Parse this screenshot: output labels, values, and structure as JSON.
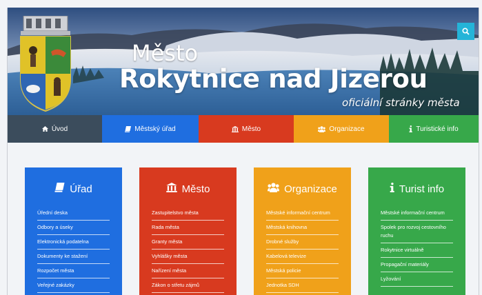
{
  "header": {
    "title_small": "Město",
    "title_big": "Rokytnice nad Jizerou",
    "subtitle": "oficiální stránky města",
    "search_icon": "search-icon"
  },
  "nav": [
    {
      "label": "Úvod",
      "icon": "home-icon",
      "color": "#3b4c5c"
    },
    {
      "label": "Městský úřad",
      "icon": "book-icon",
      "color": "#1f6ee0"
    },
    {
      "label": "Město",
      "icon": "institution-icon",
      "color": "#d83a1f"
    },
    {
      "label": "Organizace",
      "icon": "group-icon",
      "color": "#f0a11a"
    },
    {
      "label": "Turistické info",
      "icon": "info-icon",
      "color": "#37a84a"
    }
  ],
  "cards": [
    {
      "title": "Úřad",
      "icon": "book-icon",
      "color": "#1f6ee0",
      "items": [
        "Úřední deska",
        "Odbory a úseky",
        "Elektronická podatelna",
        "Dokumenty ke stažení",
        "Rozpočet města",
        "Veřejné zakázky"
      ]
    },
    {
      "title": "Město",
      "icon": "institution-icon",
      "color": "#d83a1f",
      "items": [
        "Zastupitelstvo města",
        "Rada města",
        "Granty města",
        "Vyhlášky města",
        "Nařízení města",
        "Zákon o střetu zájmů"
      ]
    },
    {
      "title": "Organizace",
      "icon": "group-icon",
      "color": "#f0a11a",
      "items": [
        "Městské informační centrum",
        "Městská knihovna",
        "Drobné služby",
        "Kabelová televize",
        "Městská policie",
        "Jednotka SDH"
      ]
    },
    {
      "title": "Turist info",
      "icon": "info-icon",
      "color": "#37a84a",
      "items": [
        "Městské informační centrum",
        "Spolek pro rozvoj cestovního ruchu",
        "Rokytnice virtuálně",
        "Propagační materiály",
        "Lyžování"
      ]
    }
  ],
  "colors": {
    "search": "#24b4d8",
    "page_bg": "#f2f4f7"
  }
}
